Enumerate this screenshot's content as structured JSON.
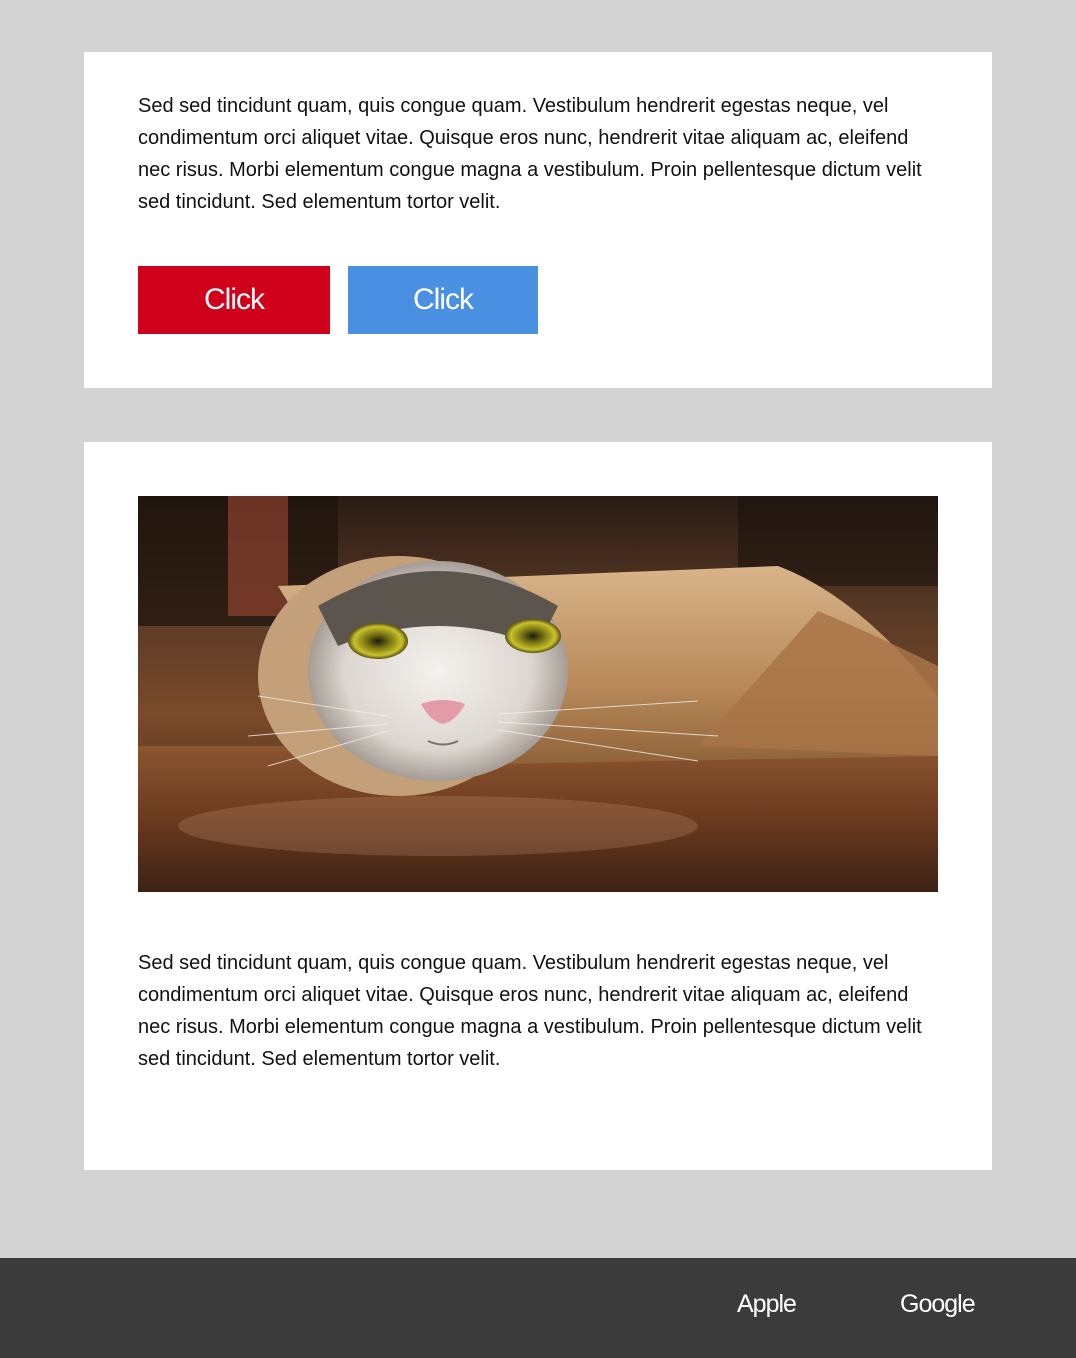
{
  "colors": {
    "page_background": "#d3d3d3",
    "card_background": "#ffffff",
    "red_button": "#d0021b",
    "blue_button": "#4a90e2",
    "footer_background": "#3b3b3b"
  },
  "card_top": {
    "paragraph": "Sed sed tincidunt quam, quis congue quam. Vestibulum hendrerit egestas neque, vel condimentum orci aliquet vitae. Quisque eros nunc, hendrerit vitae aliquam ac, eleifend nec risus. Morbi elementum congue magna a vestibulum. Proin pellentesque dictum velit sed tincidunt. Sed elementum tortor velit.",
    "button_red_label": "Click",
    "button_blue_label": "Click"
  },
  "card_bottom": {
    "image_subject": "cat-rolled-in-brown-paper-photo",
    "paragraph": "Sed sed tincidunt quam, quis congue quam. Vestibulum hendrerit egestas neque, vel condimentum orci aliquet vitae. Quisque eros nunc, hendrerit vitae aliquam ac, eleifend nec risus. Morbi elementum congue magna a vestibulum. Proin pellentesque dictum velit sed tincidunt. Sed elementum tortor velit."
  },
  "footer": {
    "links": [
      "Apple",
      "Google"
    ]
  }
}
